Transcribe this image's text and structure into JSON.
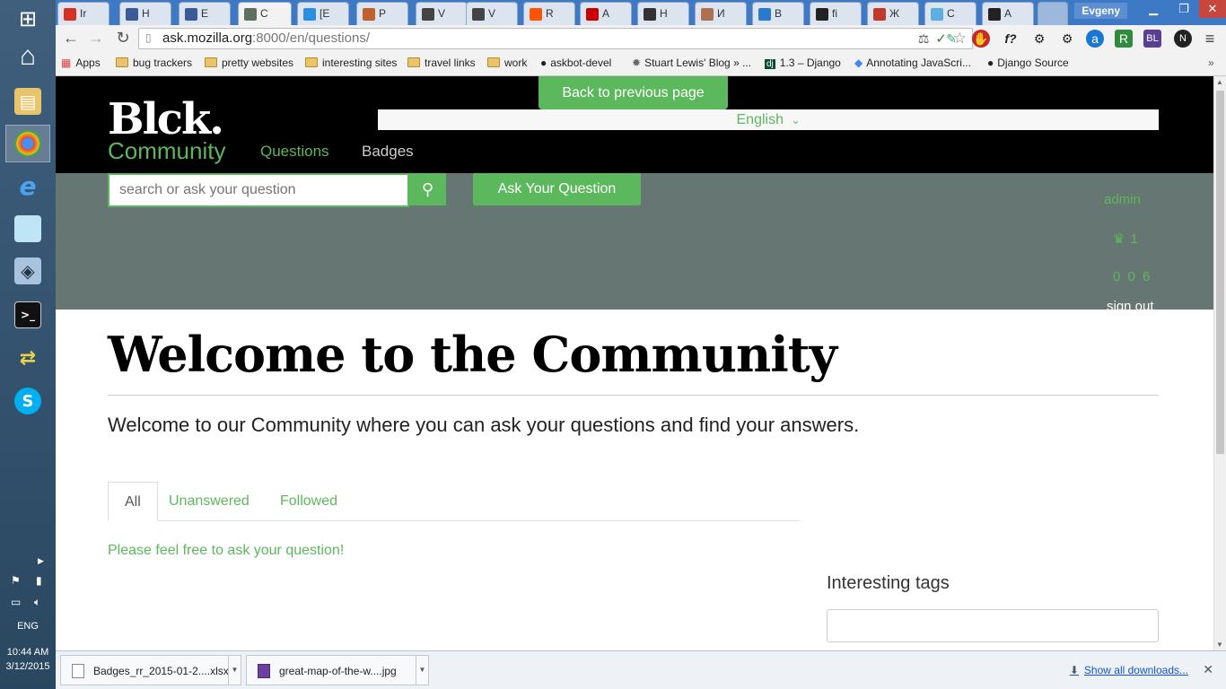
{
  "taskbar": {
    "tray": {
      "language": "ENG",
      "time": "10:44 AM",
      "date": "3/12/2015"
    }
  },
  "browser": {
    "tabs": [
      {
        "label": "Ir",
        "icon": "gmail-icon",
        "color": "#d93025"
      },
      {
        "label": "H",
        "icon": "question-icon",
        "color": "#3a5a98"
      },
      {
        "label": "E",
        "icon": "question-icon",
        "color": "#3a5a98"
      },
      {
        "label": "C",
        "icon": "page-icon",
        "color": "#607060"
      },
      {
        "label": "[E",
        "icon": "app-icon",
        "color": "#2b8fe0"
      },
      {
        "label": "P",
        "icon": "app-icon",
        "color": "#c0602a"
      },
      {
        "label": "V",
        "icon": "app-icon",
        "color": "#444444"
      },
      {
        "label": "V",
        "icon": "app-icon",
        "color": "#444444"
      },
      {
        "label": "R",
        "icon": "soundcloud-icon",
        "color": "#ff5500"
      },
      {
        "label": "A",
        "icon": "youtube-icon",
        "color": "#cc0000"
      },
      {
        "label": "H",
        "icon": "app-icon",
        "color": "#333333"
      },
      {
        "label": "И",
        "icon": "app-icon",
        "color": "#b07050"
      },
      {
        "label": "B",
        "icon": "app-icon",
        "color": "#2a7ad0"
      },
      {
        "label": "fi",
        "icon": "github-icon",
        "color": "#222222"
      },
      {
        "label": "Ж",
        "icon": "app-icon",
        "color": "#c0392b"
      },
      {
        "label": "C",
        "icon": "app-icon",
        "color": "#5ab0e0"
      },
      {
        "label": "A",
        "icon": "github-icon",
        "color": "#222222"
      }
    ],
    "profile": "Evgeny",
    "url_host": "ask.mozilla.org",
    "url_rest": ":8000/en/questions/",
    "bookmarks": [
      {
        "label": "Apps",
        "icon": "apps-icon"
      },
      {
        "label": "bug trackers",
        "icon": "folder-icon"
      },
      {
        "label": "pretty websites",
        "icon": "folder-icon"
      },
      {
        "label": "interesting sites",
        "icon": "folder-icon"
      },
      {
        "label": "travel links",
        "icon": "folder-icon"
      },
      {
        "label": "work",
        "icon": "folder-icon"
      },
      {
        "label": "askbot-devel",
        "icon": "github-icon"
      },
      {
        "label": "Stuart Lewis' Blog » ...",
        "icon": "gear-icon"
      },
      {
        "label": "1.3 – Django",
        "icon": "django-icon"
      },
      {
        "label": "Annotating JavaScri...",
        "icon": "google-icon"
      },
      {
        "label": "Django Source",
        "icon": "github-icon"
      }
    ]
  },
  "site": {
    "back_button": "Back to previous page",
    "language": "English",
    "logo": "Blck.",
    "logo_sub": "Community",
    "nav": {
      "questions": "Questions",
      "badges": "Badges"
    },
    "search": {
      "placeholder": "search or ask your question"
    },
    "ask_button": "Ask Your Question",
    "user": {
      "name": "admin",
      "reputation": "1",
      "badges": "0 0 6",
      "sign_out": "sign out"
    },
    "welcome_title": "Welcome to the Community",
    "welcome_text": "Welcome to our Community where you can ask your questions and find your answers.",
    "tabs": {
      "all": "All",
      "unanswered": "Unanswered",
      "followed": "Followed"
    },
    "empty_message": "Please feel free to ask your question!",
    "interesting_tags": "Interesting tags"
  },
  "downloads": {
    "items": [
      {
        "name": "Badges_rr_2015-01-2....xlsx"
      },
      {
        "name": "great-map-of-the-w....jpg"
      }
    ],
    "show_all": "Show all downloads..."
  },
  "colors": {
    "accent": "#5cb85c",
    "header_bg": "#000000",
    "search_band": "#667673"
  }
}
